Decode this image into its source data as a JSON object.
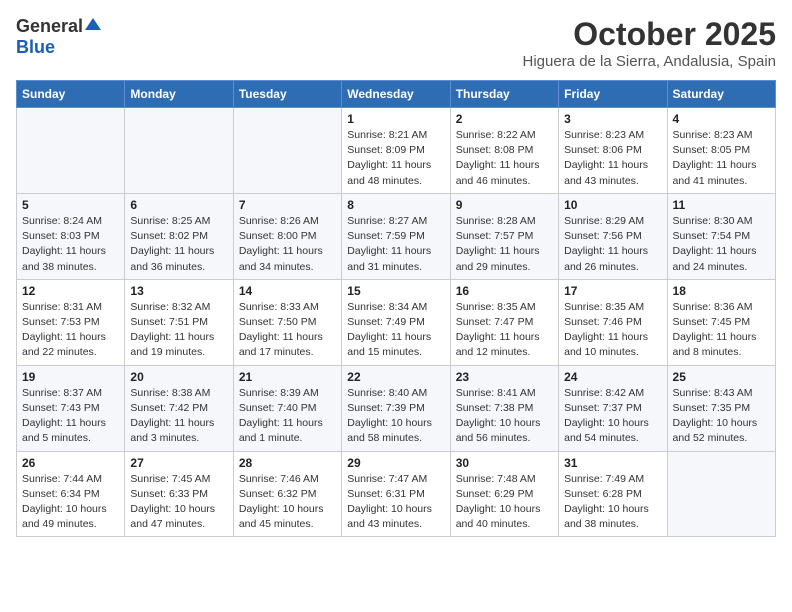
{
  "logo": {
    "general": "General",
    "blue": "Blue"
  },
  "header": {
    "month": "October 2025",
    "location": "Higuera de la Sierra, Andalusia, Spain"
  },
  "weekdays": [
    "Sunday",
    "Monday",
    "Tuesday",
    "Wednesday",
    "Thursday",
    "Friday",
    "Saturday"
  ],
  "weeks": [
    [
      {
        "day": "",
        "info": ""
      },
      {
        "day": "",
        "info": ""
      },
      {
        "day": "",
        "info": ""
      },
      {
        "day": "1",
        "info": "Sunrise: 8:21 AM\nSunset: 8:09 PM\nDaylight: 11 hours\nand 48 minutes."
      },
      {
        "day": "2",
        "info": "Sunrise: 8:22 AM\nSunset: 8:08 PM\nDaylight: 11 hours\nand 46 minutes."
      },
      {
        "day": "3",
        "info": "Sunrise: 8:23 AM\nSunset: 8:06 PM\nDaylight: 11 hours\nand 43 minutes."
      },
      {
        "day": "4",
        "info": "Sunrise: 8:23 AM\nSunset: 8:05 PM\nDaylight: 11 hours\nand 41 minutes."
      }
    ],
    [
      {
        "day": "5",
        "info": "Sunrise: 8:24 AM\nSunset: 8:03 PM\nDaylight: 11 hours\nand 38 minutes."
      },
      {
        "day": "6",
        "info": "Sunrise: 8:25 AM\nSunset: 8:02 PM\nDaylight: 11 hours\nand 36 minutes."
      },
      {
        "day": "7",
        "info": "Sunrise: 8:26 AM\nSunset: 8:00 PM\nDaylight: 11 hours\nand 34 minutes."
      },
      {
        "day": "8",
        "info": "Sunrise: 8:27 AM\nSunset: 7:59 PM\nDaylight: 11 hours\nand 31 minutes."
      },
      {
        "day": "9",
        "info": "Sunrise: 8:28 AM\nSunset: 7:57 PM\nDaylight: 11 hours\nand 29 minutes."
      },
      {
        "day": "10",
        "info": "Sunrise: 8:29 AM\nSunset: 7:56 PM\nDaylight: 11 hours\nand 26 minutes."
      },
      {
        "day": "11",
        "info": "Sunrise: 8:30 AM\nSunset: 7:54 PM\nDaylight: 11 hours\nand 24 minutes."
      }
    ],
    [
      {
        "day": "12",
        "info": "Sunrise: 8:31 AM\nSunset: 7:53 PM\nDaylight: 11 hours\nand 22 minutes."
      },
      {
        "day": "13",
        "info": "Sunrise: 8:32 AM\nSunset: 7:51 PM\nDaylight: 11 hours\nand 19 minutes."
      },
      {
        "day": "14",
        "info": "Sunrise: 8:33 AM\nSunset: 7:50 PM\nDaylight: 11 hours\nand 17 minutes."
      },
      {
        "day": "15",
        "info": "Sunrise: 8:34 AM\nSunset: 7:49 PM\nDaylight: 11 hours\nand 15 minutes."
      },
      {
        "day": "16",
        "info": "Sunrise: 8:35 AM\nSunset: 7:47 PM\nDaylight: 11 hours\nand 12 minutes."
      },
      {
        "day": "17",
        "info": "Sunrise: 8:35 AM\nSunset: 7:46 PM\nDaylight: 11 hours\nand 10 minutes."
      },
      {
        "day": "18",
        "info": "Sunrise: 8:36 AM\nSunset: 7:45 PM\nDaylight: 11 hours\nand 8 minutes."
      }
    ],
    [
      {
        "day": "19",
        "info": "Sunrise: 8:37 AM\nSunset: 7:43 PM\nDaylight: 11 hours\nand 5 minutes."
      },
      {
        "day": "20",
        "info": "Sunrise: 8:38 AM\nSunset: 7:42 PM\nDaylight: 11 hours\nand 3 minutes."
      },
      {
        "day": "21",
        "info": "Sunrise: 8:39 AM\nSunset: 7:40 PM\nDaylight: 11 hours\nand 1 minute."
      },
      {
        "day": "22",
        "info": "Sunrise: 8:40 AM\nSunset: 7:39 PM\nDaylight: 10 hours\nand 58 minutes."
      },
      {
        "day": "23",
        "info": "Sunrise: 8:41 AM\nSunset: 7:38 PM\nDaylight: 10 hours\nand 56 minutes."
      },
      {
        "day": "24",
        "info": "Sunrise: 8:42 AM\nSunset: 7:37 PM\nDaylight: 10 hours\nand 54 minutes."
      },
      {
        "day": "25",
        "info": "Sunrise: 8:43 AM\nSunset: 7:35 PM\nDaylight: 10 hours\nand 52 minutes."
      }
    ],
    [
      {
        "day": "26",
        "info": "Sunrise: 7:44 AM\nSunset: 6:34 PM\nDaylight: 10 hours\nand 49 minutes."
      },
      {
        "day": "27",
        "info": "Sunrise: 7:45 AM\nSunset: 6:33 PM\nDaylight: 10 hours\nand 47 minutes."
      },
      {
        "day": "28",
        "info": "Sunrise: 7:46 AM\nSunset: 6:32 PM\nDaylight: 10 hours\nand 45 minutes."
      },
      {
        "day": "29",
        "info": "Sunrise: 7:47 AM\nSunset: 6:31 PM\nDaylight: 10 hours\nand 43 minutes."
      },
      {
        "day": "30",
        "info": "Sunrise: 7:48 AM\nSunset: 6:29 PM\nDaylight: 10 hours\nand 40 minutes."
      },
      {
        "day": "31",
        "info": "Sunrise: 7:49 AM\nSunset: 6:28 PM\nDaylight: 10 hours\nand 38 minutes."
      },
      {
        "day": "",
        "info": ""
      }
    ]
  ]
}
